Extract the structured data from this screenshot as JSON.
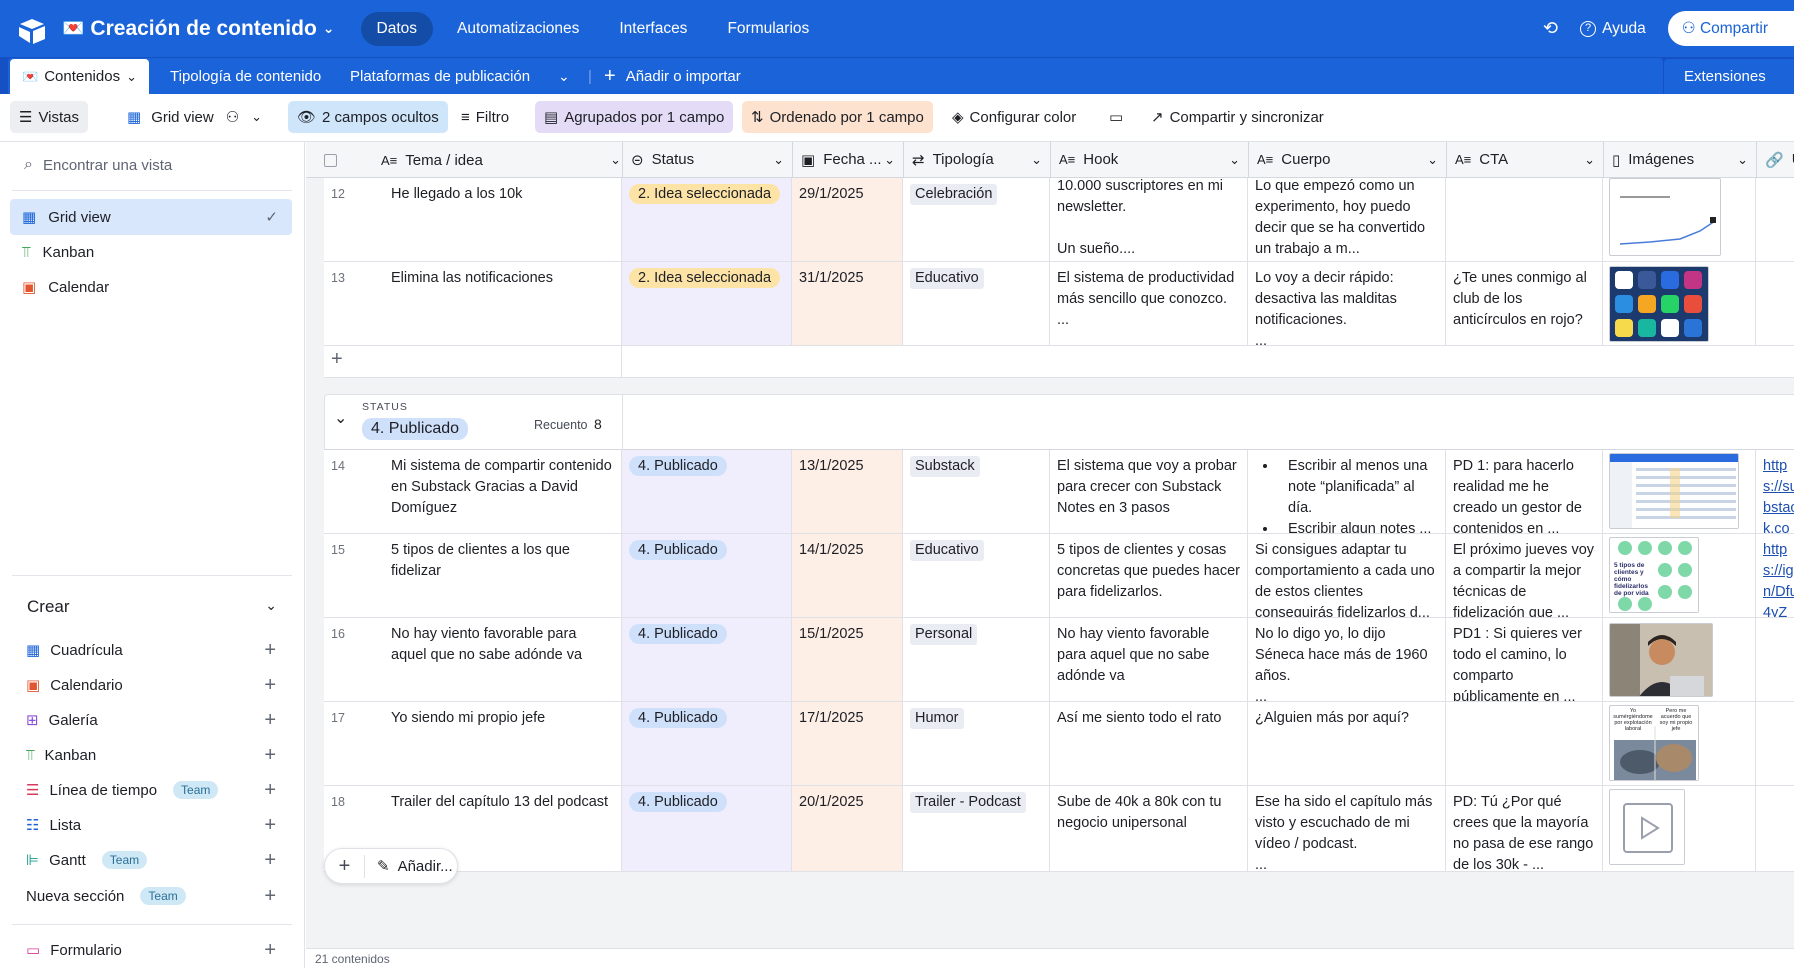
{
  "header": {
    "base_title": "Creación de contenido",
    "nav": [
      "Datos",
      "Automatizaciones",
      "Interfaces",
      "Formularios"
    ],
    "help": "Ayuda",
    "share": "Compartir"
  },
  "tabs": {
    "active": "Contenidos",
    "items": [
      "Tipología de contenido",
      "Plataformas de publicación"
    ],
    "add": "Añadir o importar",
    "extensions": "Extensiones"
  },
  "toolbar": {
    "views": "Vistas",
    "view_name": "Grid view",
    "hidden": "2 campos ocultos",
    "filter": "Filtro",
    "group": "Agrupados por 1 campo",
    "sort": "Ordenado por 1 campo",
    "color": "Configurar color",
    "share": "Compartir y sincronizar"
  },
  "sidebar": {
    "search_placeholder": "Encontrar una vista",
    "views": [
      "Grid view",
      "Kanban",
      "Calendar"
    ],
    "create_title": "Crear",
    "create_items": [
      "Cuadrícula",
      "Calendario",
      "Galería",
      "Kanban",
      "Línea de tiempo",
      "Lista",
      "Gantt"
    ],
    "team_label": "Team",
    "new_section": "Nueva sección",
    "form": "Formulario"
  },
  "columns": [
    "Tema / idea",
    "Status",
    "Fecha ...",
    "Tipología",
    "Hook",
    "Cuerpo",
    "CTA",
    "Imágenes",
    "UR"
  ],
  "group": {
    "field_label": "STATUS",
    "value": "4. Publicado",
    "count_label": "Recuento",
    "count": "8"
  },
  "rows_top": [
    {
      "num": "12",
      "tema": "He llegado a los 10k",
      "status": "2. Idea seleccionada",
      "fecha": "29/1/2025",
      "tipo": "Celebración",
      "hook": "10.000 suscriptores en mi newsletter.\n\nUn sueño....",
      "cuerpo": "Lo que empezó como un experimento, hoy puedo decir que se ha convertido un trabajo a m...",
      "cta": ""
    },
    {
      "num": "13",
      "tema": "Elimina las notificaciones",
      "status": "2. Idea seleccionada",
      "fecha": "31/1/2025",
      "tipo": "Educativo",
      "hook": "El sistema de productividad más sencillo que conozco.\n...",
      "cuerpo": "Lo voy a decir rápido: desactiva las malditas notificaciones.\n...",
      "cta": "¿Te unes conmigo al club de los anticírculos en rojo?"
    }
  ],
  "rows_pub": [
    {
      "num": "14",
      "tema": "Mi sistema de compartir contenido en Substack Gracias a David Domíguez",
      "status": "4. Publicado",
      "fecha": "13/1/2025",
      "tipo": "Substack",
      "hook": "El sistema que voy a probar para crecer con Substack Notes en 3 pasos",
      "cuerpo_b1": "Escribir al menos una note “planificada” al día.",
      "cuerpo_b2": "Escribir algun notes ...",
      "cta": "PD 1: para hacerlo realidad me he creado un gestor de contenidos en ...",
      "url": "https://substack.com/estas/quiere"
    },
    {
      "num": "15",
      "tema": "5 tipos de clientes a los que fidelizar",
      "status": "4. Publicado",
      "fecha": "14/1/2025",
      "tipo": "Educativo",
      "hook": "5 tipos de clientes y cosas concretas que puedes hacer para fidelizarlos.",
      "cuerpo": "Si consigues adaptar tu comportamiento a cada uno de estos clientes conseguirás fidelizarlos d...",
      "cta": "El próximo jueves voy a compartir la mejor técnicas de fidelización que ...",
      "url": "https://ign/Dfu4yZ"
    },
    {
      "num": "16",
      "tema": "No hay viento favorable para aquel que no sabe adónde va",
      "status": "4. Publicado",
      "fecha": "15/1/2025",
      "tipo": "Personal",
      "hook": "No hay viento favorable para aquel que no sabe adónde va",
      "cuerpo": "No lo digo yo, lo dijo Séneca hace más de 1960 años.\n...",
      "cta": "PD1 : Si quieres ver todo el camino, lo comparto públicamente en ...",
      "url": ""
    },
    {
      "num": "17",
      "tema": "Yo siendo mi propio jefe",
      "status": "4. Publicado",
      "fecha": "17/1/2025",
      "tipo": "Humor",
      "hook": "Así me siento todo el rato",
      "cuerpo": "¿Alguien más por aquí?",
      "cta": "",
      "url": ""
    },
    {
      "num": "18",
      "tema": "Trailer del capítulo 13 del podcast",
      "status": "4. Publicado",
      "fecha": "20/1/2025",
      "tipo": "Trailer - Podcast",
      "hook": "Sube de 40k a 80k con tu negocio unipersonal",
      "cuerpo": "Ese ha sido el capítulo más visto y escuchado de mi vídeo / podcast.\n...",
      "cta": "PD: Tú ¿Por qué crees que la mayoría no pasa de ese rango de los 30k - ...",
      "url": ""
    }
  ],
  "thumb_text": {
    "clientes": "5 tipos de clientes y cómo fidelizarlos de por vida",
    "meme_left": "Yo sumérgiéndome por explotación laboral",
    "meme_right": "Pero me acuerdo que soy mi propio jefe"
  },
  "footer": {
    "add": "Añadir...",
    "count": "21 contenidos"
  },
  "colors": {
    "brand": "#1a63d8",
    "idea_pill": "#fde3a6",
    "publicado_pill": "#cfe0fb",
    "status_col": "#f0eefc",
    "date_col": "#fdeee6"
  }
}
